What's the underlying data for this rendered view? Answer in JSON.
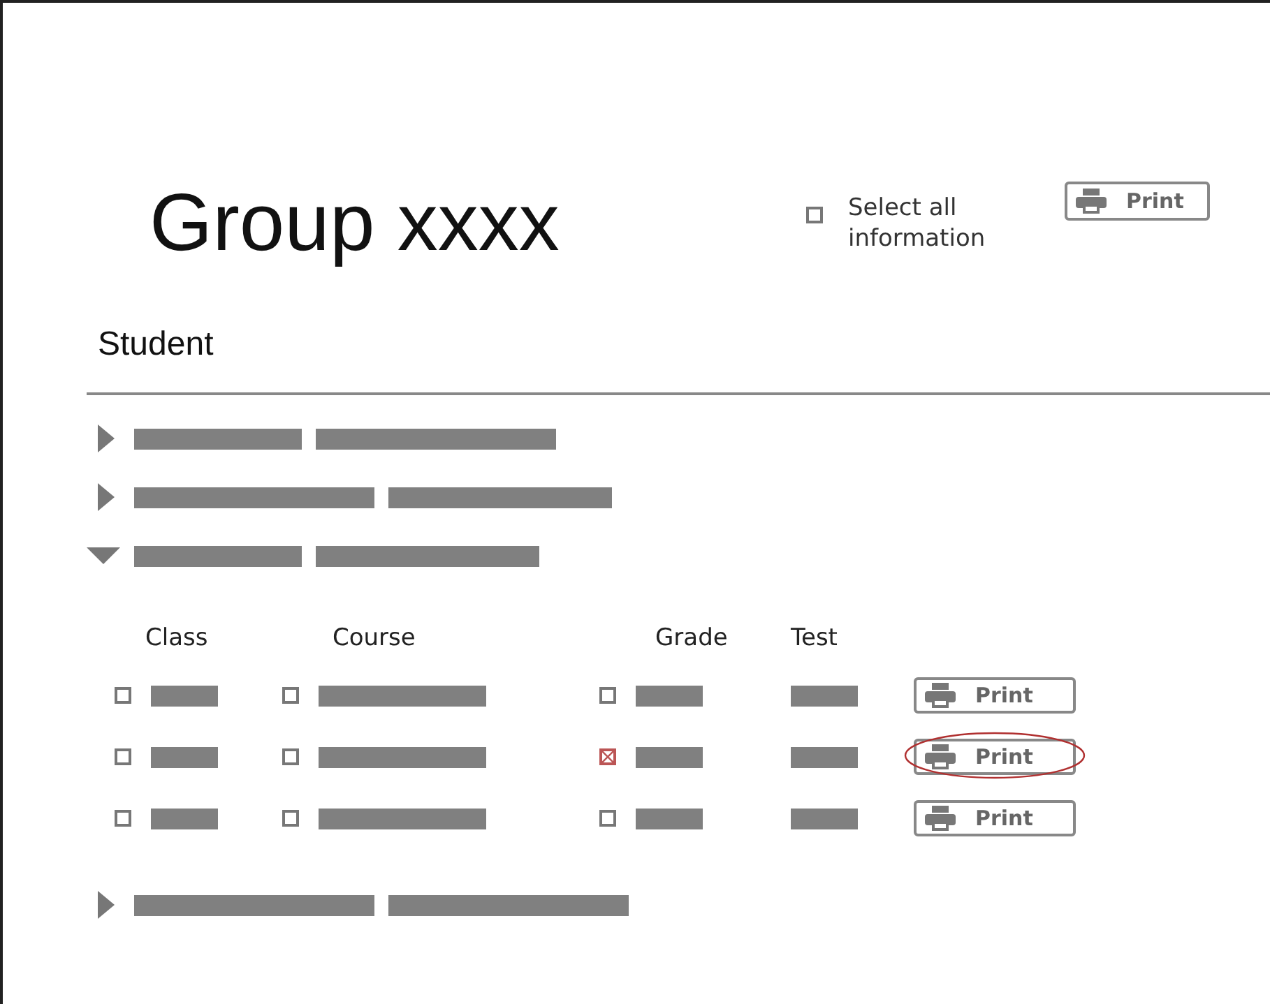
{
  "title": "Group xxxx",
  "select_all": {
    "label": "Select all information",
    "checked": false
  },
  "print_button": {
    "label": "Print"
  },
  "section": "Student",
  "groups": [
    {
      "expanded": false
    },
    {
      "expanded": false
    },
    {
      "expanded": true,
      "columns": [
        "Class",
        "Course",
        "Grade",
        "Test"
      ],
      "rows": [
        {
          "class_checked": false,
          "course_checked": false,
          "grade_checked": false,
          "print": "Print",
          "highlighted": false
        },
        {
          "class_checked": false,
          "course_checked": false,
          "grade_checked": true,
          "print": "Print",
          "highlighted": true
        },
        {
          "class_checked": false,
          "course_checked": false,
          "grade_checked": false,
          "print": "Print",
          "highlighted": false
        }
      ]
    },
    {
      "expanded": false
    }
  ]
}
